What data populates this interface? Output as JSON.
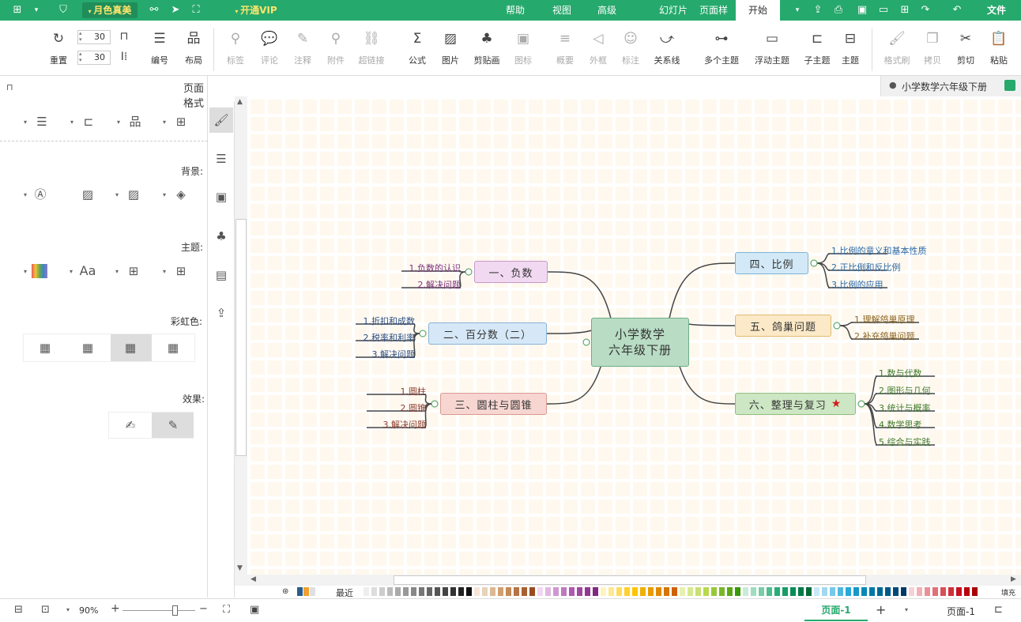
{
  "titlebar": {
    "file": "文件",
    "tab_start": "开始",
    "tabs": [
      "页面样式",
      "幻灯片",
      "高级",
      "视图",
      "帮助"
    ],
    "vip": "开通VIP",
    "theme": "月色真美"
  },
  "ribbon": {
    "paste": "粘贴",
    "cut": "剪切",
    "copy": "拷贝",
    "format_brush": "格式刷",
    "topic": "主题",
    "subtopic": "子主题",
    "float_topic": "浮动主题",
    "multi_topic": "多个主题",
    "relation": "关系线",
    "callout": "标注",
    "boundary": "外框",
    "summary": "概要",
    "icon": "图标",
    "clipart": "剪贴画",
    "picture": "图片",
    "formula": "公式",
    "hyperlink": "超链接",
    "attachment": "附件",
    "note": "注释",
    "comment": "评论",
    "tag": "标签",
    "layout": "布局",
    "numbering": "编号",
    "reset": "重置",
    "spacing_h": "30",
    "spacing_v": "30"
  },
  "left_panel": {
    "title": "页面格式",
    "background": "背景:",
    "theme": "主题:",
    "rainbow": "彩虹色:",
    "effect": "效果:",
    "font_label": "Aa"
  },
  "doc_tab": "小学数学六年级下册",
  "mindmap": {
    "root": [
      "小学数学",
      "六年级下册"
    ],
    "branches": [
      {
        "label": "一、负数",
        "color": "#f2d9f2",
        "border": "#c79ac7",
        "leaves": [
          "1.负数的认识",
          "2.解决问题"
        ],
        "leaf_color": "#7a2f7a"
      },
      {
        "label": "二、百分数（二）",
        "color": "#d6e8f7",
        "border": "#86b3d9",
        "leaves": [
          "1.折扣和成数",
          "2.税率和利率",
          "3.解决问题"
        ],
        "leaf_color": "#2b4f86"
      },
      {
        "label": "三、圆柱与圆锥",
        "color": "#f7d6d1",
        "border": "#d99a90",
        "leaves": [
          "1.圆柱",
          "2.圆锥",
          "3.解决问题"
        ],
        "leaf_color": "#8a3b2f"
      },
      {
        "label": "四、比例",
        "color": "#d3e9f7",
        "border": "#7db4d6",
        "leaves": [
          "1.比例的意义和基本性质",
          "2.正比例和反比例",
          "3.比例的应用"
        ],
        "leaf_color": "#2b6aa8"
      },
      {
        "label": "五、鸽巢问题",
        "color": "#fbe9c7",
        "border": "#e0bb74",
        "leaves": [
          "1.理解鸽巢原理",
          "2.补充鸽巢问题"
        ],
        "leaf_color": "#8a6420"
      },
      {
        "label": "六、整理与复习",
        "color": "#cde6c3",
        "border": "#8fbf7c",
        "leaves": [
          "1.数与代数",
          "2.图形与几何",
          "3.统计与概率",
          "4.数学思考",
          "5.综合与实践"
        ],
        "leaf_color": "#3f7a2a"
      }
    ]
  },
  "palette": {
    "recent": "最近",
    "fill": "填充"
  },
  "status": {
    "page_tab": "页面-1",
    "page_label": "页面-1",
    "zoom": "90%"
  },
  "colors": {
    "brand": "#26a96c"
  }
}
